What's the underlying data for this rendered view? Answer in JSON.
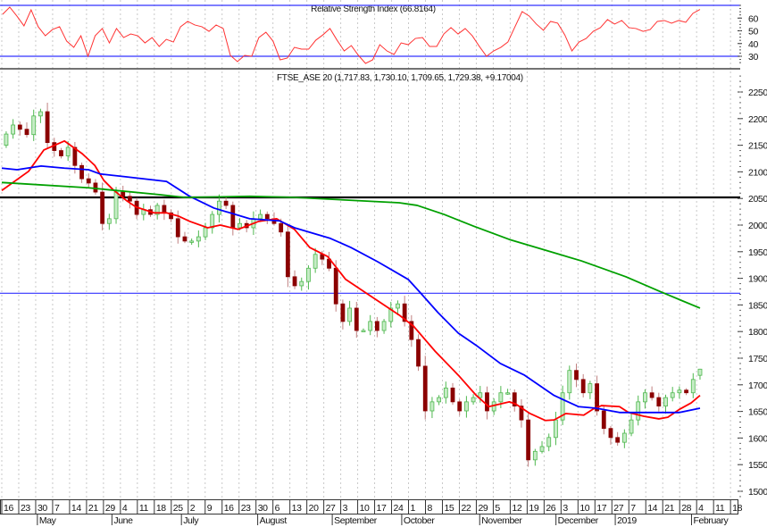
{
  "rsi_panel": {
    "title": "Relative Strength Index (66.8164)",
    "ticks": [
      "60",
      "50",
      "40",
      "30"
    ]
  },
  "price_panel": {
    "title": "FTSE_ASE 20 (1,717.83, 1,730.10, 1,709.65, 1,729.38, +9.17004)"
  },
  "colors": {
    "up": "#4fb84f",
    "up_fill": "#c6ecc6",
    "down": "#8b0000",
    "ma_short": "#ff0000",
    "ma_mid": "#0000ff",
    "ma_long": "#00a000",
    "rsi": "#ff3333",
    "hline_black": "#000000",
    "hline_blue": "#3333ff",
    "grid": "#c8c8c8"
  },
  "chart_data": [
    {
      "type": "line",
      "title": "Relative Strength Index (66.8164)",
      "ylim": [
        25,
        70
      ],
      "yticks": [
        60,
        50,
        40,
        30
      ],
      "reference_lines": [
        70,
        30
      ],
      "x_start_week": 0.05,
      "x_end_week": 41.2,
      "values": [
        63,
        68.6,
        61.6,
        53.9,
        66.5,
        53.2,
        46.1,
        51,
        53.2,
        41.9,
        37,
        46.1,
        30,
        46.1,
        51.8,
        40.5,
        51.8,
        44.7,
        47.5,
        46.1,
        40.5,
        44.7,
        37.7,
        43.3,
        41.2,
        53.2,
        57.4,
        54.6,
        53.2,
        49.6,
        54.6,
        51.8,
        30.7,
        25.8,
        30.7,
        30,
        44.7,
        48.9,
        41.9,
        27.2,
        28.6,
        37,
        35.6,
        35.6,
        42.6,
        46.8,
        51.8,
        42.6,
        34.2,
        38.4,
        30.7,
        24.4,
        27.2,
        39.1,
        34.2,
        31.4,
        40.5,
        39.1,
        44,
        44.7,
        37.7,
        37.7,
        47.5,
        52.5,
        47.5,
        51.8,
        46.1,
        37.7,
        30,
        34.2,
        37,
        41.2,
        53.2,
        65.1,
        61.6,
        55.3,
        50.4,
        57.4,
        56,
        46.8,
        34.2,
        41.2,
        44,
        49.6,
        52.5,
        58.8,
        55.3,
        58.1,
        52.5,
        51.8,
        49.6,
        51,
        57.4,
        58.1,
        56,
        58.1,
        56.7,
        63.7,
        66.8
      ]
    },
    {
      "type": "candlestick",
      "title": "FTSE_ASE 20",
      "ylim": [
        1500,
        2250
      ],
      "yticks": [
        "2250",
        "2200",
        "2150",
        "2100",
        "2050",
        "2000",
        "1950",
        "1900",
        "1850",
        "1800",
        "1750",
        "1700",
        "1650",
        "1600",
        "1550",
        "1500"
      ],
      "first_open": 2150,
      "x_start_week": 0.26,
      "x_end_week": 41.2,
      "closes": [
        2171,
        2188,
        2180,
        2170,
        2205,
        2213,
        2155,
        2140,
        2130,
        2146,
        2112,
        2087,
        2079,
        2062,
        2003,
        2012,
        2062,
        2054,
        2045,
        2020,
        2029,
        2020,
        2037,
        2023,
        2012,
        1978,
        1970,
        1970,
        1978,
        1995,
        2020,
        2045,
        2037,
        1995,
        2003,
        1995,
        2012,
        2020,
        2012,
        2003,
        1987,
        1903,
        1886,
        1894,
        1919,
        1945,
        1936,
        1919,
        1852,
        1819,
        1844,
        1802,
        1802,
        1819,
        1802,
        1819,
        1844,
        1852,
        1819,
        1785,
        1735,
        1651,
        1668,
        1676,
        1694,
        1668,
        1651,
        1668,
        1676,
        1685,
        1651,
        1668,
        1685,
        1685,
        1660,
        1634,
        1559,
        1575,
        1584,
        1601,
        1634,
        1685,
        1727,
        1710,
        1685,
        1702,
        1651,
        1618,
        1601,
        1592,
        1609,
        1634,
        1668,
        1685,
        1676,
        1660,
        1676,
        1685,
        1690,
        1685,
        1710,
        1729.38
      ],
      "last_bar": {
        "open": 1717.83,
        "high": 1730.1,
        "low": 1709.65,
        "close": 1729.38,
        "change": 9.17004
      },
      "horizontal_lines": [
        {
          "value": 2052,
          "color": "black"
        },
        {
          "value": 1872,
          "color": "blue"
        }
      ],
      "moving_averages": [
        {
          "name": "short",
          "points": [
            [
              0,
              2065
            ],
            [
              1.58,
              2101
            ],
            [
              2.48,
              2141
            ],
            [
              3.7,
              2158
            ],
            [
              4.75,
              2134
            ],
            [
              5.49,
              2112
            ],
            [
              6.02,
              2084
            ],
            [
              6.55,
              2067
            ],
            [
              7.4,
              2045
            ],
            [
              7.92,
              2034
            ],
            [
              8.98,
              2023
            ],
            [
              9.72,
              2023
            ],
            [
              10.41,
              2017
            ],
            [
              11.09,
              2007
            ],
            [
              12.15,
              1995
            ],
            [
              12.89,
              2000
            ],
            [
              13.95,
              1992
            ],
            [
              15.16,
              2007
            ],
            [
              16.22,
              2012
            ],
            [
              17.27,
              1992
            ],
            [
              18.17,
              1958
            ],
            [
              19.23,
              1941
            ],
            [
              20.29,
              1898
            ],
            [
              21.66,
              1869
            ],
            [
              23.45,
              1831
            ],
            [
              24.3,
              1810
            ],
            [
              25.57,
              1763
            ],
            [
              26.94,
              1718
            ],
            [
              28,
              1680
            ],
            [
              28.74,
              1659
            ],
            [
              29.95,
              1668
            ],
            [
              30.32,
              1664
            ],
            [
              31.17,
              1646
            ],
            [
              32.07,
              1633
            ],
            [
              32.59,
              1634
            ],
            [
              33.28,
              1646
            ],
            [
              34.34,
              1643
            ],
            [
              34.87,
              1654
            ],
            [
              35.39,
              1661
            ],
            [
              36.45,
              1659
            ],
            [
              36.98,
              1648
            ],
            [
              37.88,
              1641
            ],
            [
              38.77,
              1636
            ],
            [
              39.3,
              1639
            ],
            [
              39.99,
              1654
            ],
            [
              40.68,
              1666
            ],
            [
              41.2,
              1680
            ]
          ]
        },
        {
          "name": "mid",
          "points": [
            [
              0,
              2107
            ],
            [
              0.9,
              2104
            ],
            [
              2.32,
              2111
            ],
            [
              3.7,
              2107
            ],
            [
              5.12,
              2104
            ],
            [
              5.81,
              2096
            ],
            [
              7.24,
              2091
            ],
            [
              9.72,
              2082
            ],
            [
              11.09,
              2054
            ],
            [
              12.52,
              2032
            ],
            [
              14.63,
              2012
            ],
            [
              16.38,
              2008
            ],
            [
              17.27,
              1995
            ],
            [
              19.39,
              1975
            ],
            [
              20.6,
              1958
            ],
            [
              22.19,
              1931
            ],
            [
              23.98,
              1898
            ],
            [
              24.67,
              1874
            ],
            [
              25.73,
              1836
            ],
            [
              26.94,
              1797
            ],
            [
              28,
              1774
            ],
            [
              29.42,
              1740
            ],
            [
              30.85,
              1718
            ],
            [
              32.59,
              1680
            ],
            [
              34.02,
              1659
            ],
            [
              35.08,
              1656
            ],
            [
              36.45,
              1648
            ],
            [
              37.72,
              1648
            ],
            [
              39.99,
              1648
            ],
            [
              41.2,
              1656
            ]
          ]
        },
        {
          "name": "long",
          "points": [
            [
              0,
              2080
            ],
            [
              5.12,
              2070
            ],
            [
              9.35,
              2057
            ],
            [
              10.78,
              2052
            ],
            [
              14.63,
              2054
            ],
            [
              17.27,
              2052
            ],
            [
              23.45,
              2042
            ],
            [
              24.51,
              2037
            ],
            [
              26.1,
              2020
            ],
            [
              27.84,
              1998
            ],
            [
              29.95,
              1973
            ],
            [
              34.18,
              1933
            ],
            [
              36.82,
              1903
            ],
            [
              38.93,
              1874
            ],
            [
              41.2,
              1844
            ]
          ]
        }
      ]
    }
  ],
  "x_axis": {
    "week_labels": [
      "16",
      "23",
      "30",
      "7",
      "14",
      "21",
      "29",
      "4",
      "11",
      "18",
      "25",
      "2",
      "9",
      "16",
      "23",
      "30",
      "6",
      "13",
      "20",
      "27",
      "3",
      "10",
      "17",
      "24",
      "1",
      "8",
      "15",
      "22",
      "29",
      "5",
      "12",
      "19",
      "26",
      "3",
      "10",
      "17",
      "27",
      "7",
      "14",
      "21",
      "28",
      "4",
      "11",
      "18"
    ],
    "months": [
      {
        "label": "May",
        "week": 2.1
      },
      {
        "label": "June",
        "week": 6.5
      },
      {
        "label": "July",
        "week": 10.6
      },
      {
        "label": "August",
        "week": 15.1
      },
      {
        "label": "September",
        "week": 19.5
      },
      {
        "label": "October",
        "week": 23.6
      },
      {
        "label": "November",
        "week": 28.2
      },
      {
        "label": "December",
        "week": 32.7
      },
      {
        "label": "2019",
        "week": 36.2
      },
      {
        "label": "February",
        "week": 40.7
      }
    ]
  }
}
